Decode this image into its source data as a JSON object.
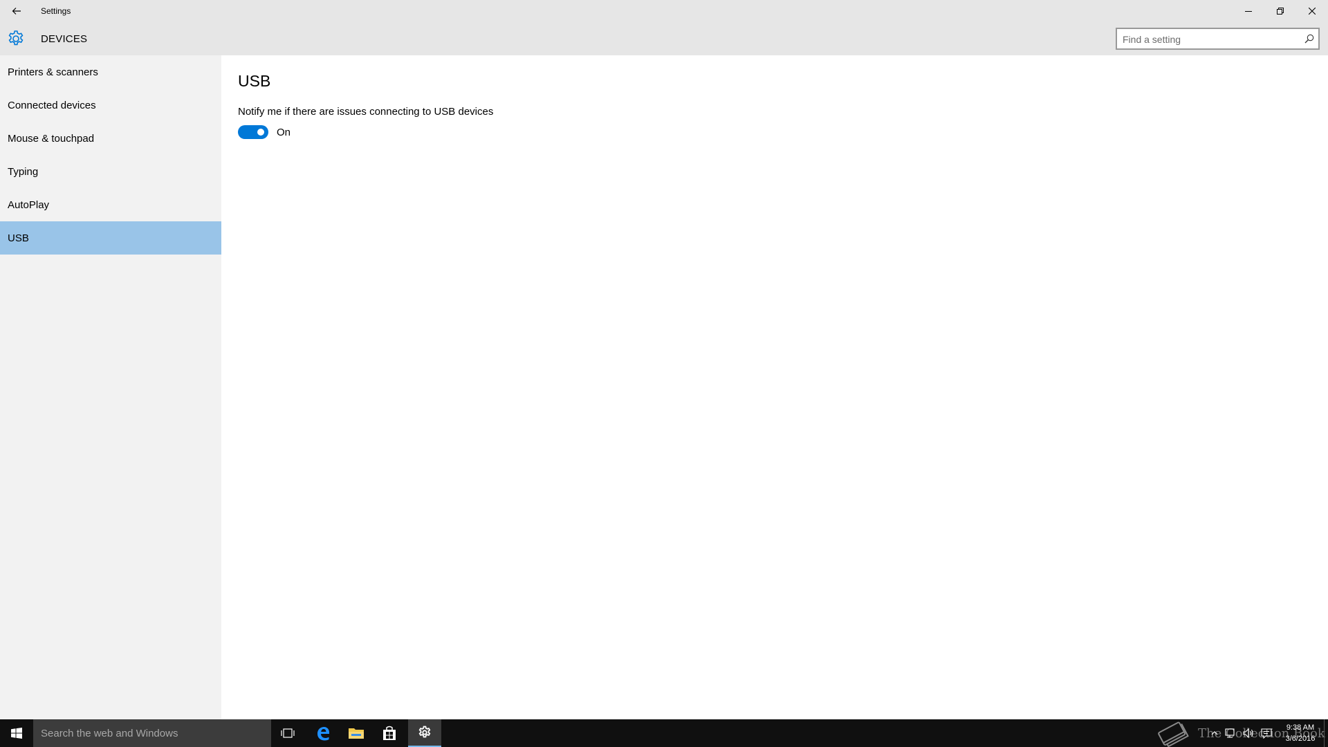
{
  "window": {
    "title": "Settings",
    "back_icon": "arrow-left-icon",
    "minimize_icon": "minimize-icon",
    "maximize_icon": "restore-icon",
    "close_icon": "close-icon"
  },
  "header": {
    "icon": "gear-icon",
    "title": "DEVICES",
    "search_placeholder": "Find a setting",
    "search_icon": "search-icon",
    "accent_color": "#0078d7"
  },
  "sidebar": {
    "items": [
      {
        "label": "Printers & scanners",
        "selected": false
      },
      {
        "label": "Connected devices",
        "selected": false
      },
      {
        "label": "Mouse & touchpad",
        "selected": false
      },
      {
        "label": "Typing",
        "selected": false
      },
      {
        "label": "AutoPlay",
        "selected": false
      },
      {
        "label": "USB",
        "selected": true
      }
    ],
    "selected_color": "#99c4e8"
  },
  "main": {
    "heading": "USB",
    "setting_label": "Notify me if there are issues connecting to USB devices",
    "toggle_on": true,
    "toggle_state_text": "On"
  },
  "taskbar": {
    "search_placeholder": "Search the web and Windows",
    "icons": [
      "windows-start-icon",
      "task-view-icon",
      "edge-browser-icon",
      "file-explorer-icon",
      "store-icon",
      "settings-gear-icon"
    ],
    "watermark_text": "The Collection Book",
    "tray_icons": [
      "chevron-up-icon",
      "network-icon",
      "volume-icon",
      "action-center-icon"
    ],
    "time": "9:38 AM",
    "date": "3/6/2016"
  }
}
